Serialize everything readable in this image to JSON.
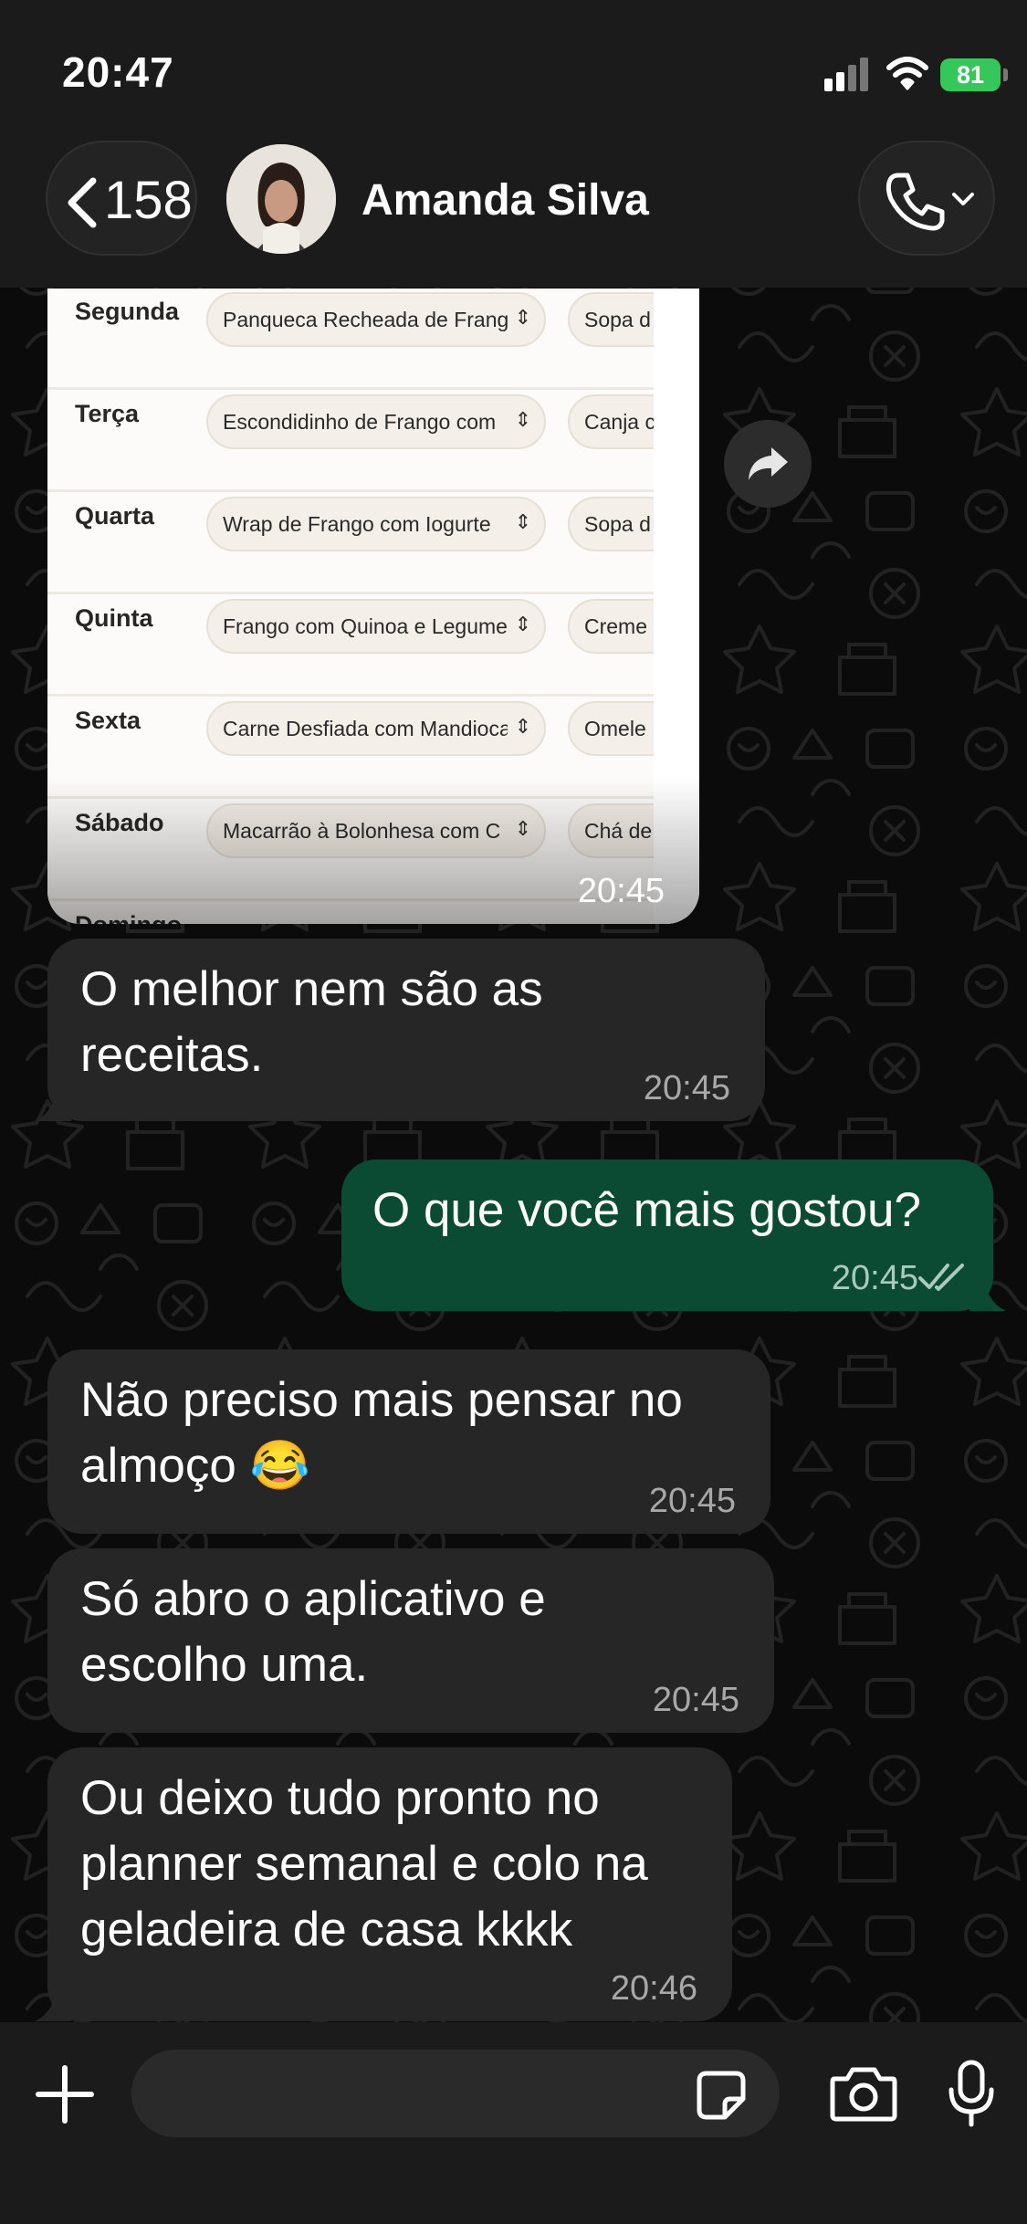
{
  "status_bar": {
    "time": "20:47",
    "battery": "81"
  },
  "header": {
    "back_count": "158",
    "contact_name": "Amanda Silva"
  },
  "image_message": {
    "time": "20:45",
    "plan_rows": [
      {
        "day": "Segunda",
        "lunch": "Panqueca Recheada de Frango",
        "dinner": "Sopa d"
      },
      {
        "day": "Terça",
        "lunch": "Escondidinho de Frango com",
        "dinner": "Canja c"
      },
      {
        "day": "Quarta",
        "lunch": "Wrap de Frango com Iogurte",
        "dinner": "Sopa d"
      },
      {
        "day": "Quinta",
        "lunch": "Frango com Quinoa e Legumes",
        "dinner": "Creme"
      },
      {
        "day": "Sexta",
        "lunch": "Carne Desfiada com Mandioca",
        "dinner": "Omele"
      },
      {
        "day": "Sábado",
        "lunch": "Macarrão à Bolonhesa com C",
        "dinner": "Chá de"
      },
      {
        "day": "Domingo",
        "lunch": "",
        "dinner": ""
      }
    ]
  },
  "messages": [
    {
      "direction": "incoming",
      "text_lines": [
        "O melhor nem são as",
        "receitas."
      ],
      "time": "20:45"
    },
    {
      "direction": "outgoing",
      "text_lines": [
        "O que você mais gostou?"
      ],
      "time": "20:45",
      "status": "read"
    },
    {
      "direction": "incoming",
      "text_lines": [
        "Não preciso mais pensar no",
        "almoço 😂"
      ],
      "time": "20:45"
    },
    {
      "direction": "incoming",
      "text_lines": [
        "Só abro o aplicativo e",
        "escolho uma."
      ],
      "time": "20:45"
    },
    {
      "direction": "incoming",
      "text_lines": [
        "Ou deixo tudo pronto no",
        "planner semanal e colo na",
        "geladeira de casa kkkk"
      ],
      "time": "20:46"
    }
  ],
  "input_bar": {
    "placeholder": ""
  },
  "icons": {
    "back": "chevron-left-icon",
    "call": "phone-icon",
    "forward": "forward-icon",
    "add": "plus-icon",
    "sticker": "sticker-icon",
    "camera": "camera-icon",
    "mic": "microphone-icon",
    "read_receipt": "double-check-icon"
  },
  "colors": {
    "background": "#0b0b0b",
    "bar": "#1b1b1b",
    "incoming_bubble": "#262626",
    "outgoing_bubble": "#0b4a33",
    "battery": "#35c759"
  }
}
